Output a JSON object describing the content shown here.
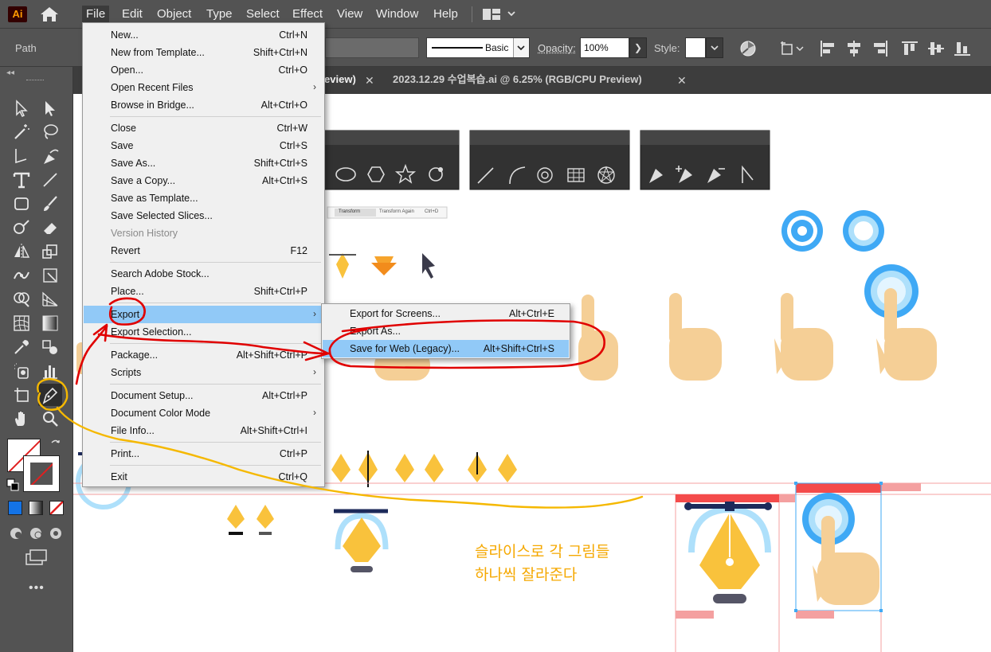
{
  "app": {
    "logo": "Ai"
  },
  "menubar": {
    "items": [
      "File",
      "Edit",
      "Object",
      "Type",
      "Select",
      "Effect",
      "View",
      "Window",
      "Help"
    ],
    "active": "File"
  },
  "controlbar": {
    "selection_label": "Path",
    "stroke_profile": "Basic",
    "opacity_label": "Opacity:",
    "opacity_value": "100%",
    "style_label": "Style:"
  },
  "tabs": [
    {
      "label": "review)",
      "close": "✕"
    },
    {
      "label": "2023.12.29 수업복습.ai @ 6.25% (RGB/CPU Preview)",
      "close": "✕"
    }
  ],
  "file_menu": {
    "groups": [
      [
        {
          "label": "New...",
          "shortcut": "Ctrl+N"
        },
        {
          "label": "New from Template...",
          "shortcut": "Shift+Ctrl+N"
        },
        {
          "label": "Open...",
          "shortcut": "Ctrl+O"
        },
        {
          "label": "Open Recent Files",
          "shortcut": "",
          "submenu": true
        },
        {
          "label": "Browse in Bridge...",
          "shortcut": "Alt+Ctrl+O"
        }
      ],
      [
        {
          "label": "Close",
          "shortcut": "Ctrl+W"
        },
        {
          "label": "Save",
          "shortcut": "Ctrl+S"
        },
        {
          "label": "Save As...",
          "shortcut": "Shift+Ctrl+S"
        },
        {
          "label": "Save a Copy...",
          "shortcut": "Alt+Ctrl+S"
        },
        {
          "label": "Save as Template...",
          "shortcut": ""
        },
        {
          "label": "Save Selected Slices...",
          "shortcut": ""
        },
        {
          "label": "Version History",
          "shortcut": "",
          "disabled": true
        },
        {
          "label": "Revert",
          "shortcut": "F12"
        }
      ],
      [
        {
          "label": "Search Adobe Stock...",
          "shortcut": ""
        },
        {
          "label": "Place...",
          "shortcut": "Shift+Ctrl+P"
        }
      ],
      [
        {
          "label": "Export",
          "shortcut": "",
          "submenu": true,
          "highlighted": true
        },
        {
          "label": "Export Selection...",
          "shortcut": ""
        }
      ],
      [
        {
          "label": "Package...",
          "shortcut": "Alt+Shift+Ctrl+P"
        },
        {
          "label": "Scripts",
          "shortcut": "",
          "submenu": true
        }
      ],
      [
        {
          "label": "Document Setup...",
          "shortcut": "Alt+Ctrl+P"
        },
        {
          "label": "Document Color Mode",
          "shortcut": "",
          "submenu": true
        },
        {
          "label": "File Info...",
          "shortcut": "Alt+Shift+Ctrl+I"
        }
      ],
      [
        {
          "label": "Print...",
          "shortcut": "Ctrl+P"
        }
      ],
      [
        {
          "label": "Exit",
          "shortcut": "Ctrl+Q"
        }
      ]
    ]
  },
  "export_menu": {
    "items": [
      {
        "label": "Export for Screens...",
        "shortcut": "Alt+Ctrl+E"
      },
      {
        "label": "Export As...",
        "shortcut": ""
      },
      {
        "label": "Save for Web (Legacy)...",
        "shortcut": "Alt+Shift+Ctrl+S",
        "highlighted": true
      }
    ]
  },
  "canvas": {
    "thumbnail_menu": {
      "left": "Transform",
      "middle": "Transform Again",
      "right": "Ctrl+D"
    },
    "annotation_lines": [
      "슬라이스로 각 그림들",
      "하나씩 잘라준다"
    ]
  },
  "colors": {
    "accent_highlight": "#91c9f7",
    "annotation_orange": "#f5a800",
    "annotation_red": "#e00000",
    "slice_red": "#f44b4b",
    "icon_blue": "#3fa9f5",
    "pen_yellow": "#f9c23c",
    "hand_skin": "#f5cf96"
  },
  "icons": [
    "home-icon",
    "workspace-grid-icon",
    "selection-tool-icon",
    "direct-selection-tool-icon",
    "pen-tool-icon",
    "type-tool-icon",
    "hand-tool-icon",
    "zoom-tool-icon",
    "chevron-down-icon",
    "close-icon",
    "submenu-arrow-icon"
  ]
}
